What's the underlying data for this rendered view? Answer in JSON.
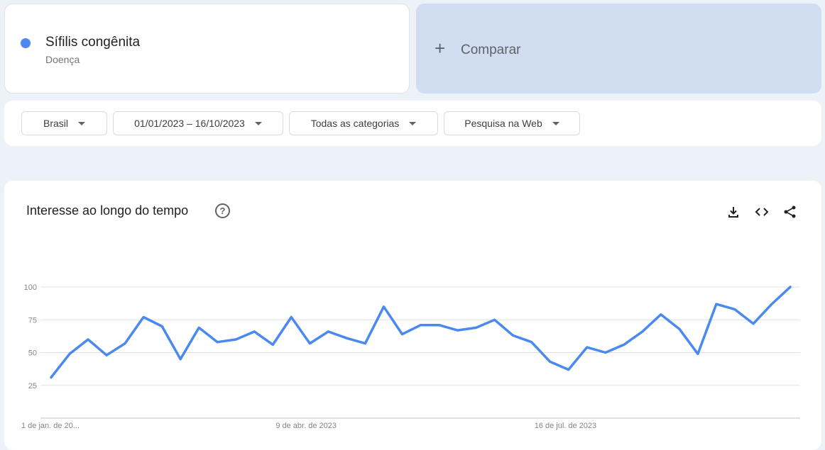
{
  "term": {
    "name": "Sífilis congênita",
    "type": "Doença",
    "dot_color": "#4a89ef"
  },
  "compare": {
    "label": "Comparar",
    "icon": "plus-icon"
  },
  "filters": {
    "region": "Brasil",
    "date_range": "01/01/2023 – 16/10/2023",
    "category": "Todas as categorias",
    "search_type": "Pesquisa na Web"
  },
  "panel": {
    "title": "Interesse ao longo do tempo",
    "help_icon": "?",
    "actions": [
      "download-icon",
      "embed-icon",
      "share-icon"
    ]
  },
  "chart_data": {
    "type": "line",
    "title": "",
    "xlabel": "",
    "ylabel": "",
    "ylim": [
      0,
      100
    ],
    "yticks": [
      25,
      50,
      75,
      100
    ],
    "xtick_labels": [
      "1 de jan. de 20...",
      "9 de abr. de 2023",
      "16 de jul. de 2023"
    ],
    "grid": true,
    "color": "#4a89ef",
    "x": [
      "2023-01-01",
      "2023-01-08",
      "2023-01-15",
      "2023-01-22",
      "2023-01-29",
      "2023-02-05",
      "2023-02-12",
      "2023-02-19",
      "2023-02-26",
      "2023-03-05",
      "2023-03-12",
      "2023-03-19",
      "2023-03-26",
      "2023-04-02",
      "2023-04-09",
      "2023-04-16",
      "2023-04-23",
      "2023-04-30",
      "2023-05-07",
      "2023-05-14",
      "2023-05-21",
      "2023-05-28",
      "2023-06-04",
      "2023-06-11",
      "2023-06-18",
      "2023-06-25",
      "2023-07-02",
      "2023-07-09",
      "2023-07-16",
      "2023-07-23",
      "2023-07-30",
      "2023-08-06",
      "2023-08-13",
      "2023-08-20",
      "2023-08-27",
      "2023-09-03",
      "2023-09-10",
      "2023-09-17",
      "2023-09-24",
      "2023-10-01",
      "2023-10-08"
    ],
    "values": [
      31,
      49,
      60,
      48,
      57,
      77,
      70,
      45,
      69,
      58,
      60,
      66,
      56,
      77,
      57,
      66,
      61,
      57,
      85,
      64,
      71,
      71,
      67,
      69,
      75,
      63,
      58,
      43,
      37,
      54,
      50,
      56,
      66,
      79,
      68,
      49,
      87,
      83,
      72,
      87,
      100
    ]
  }
}
